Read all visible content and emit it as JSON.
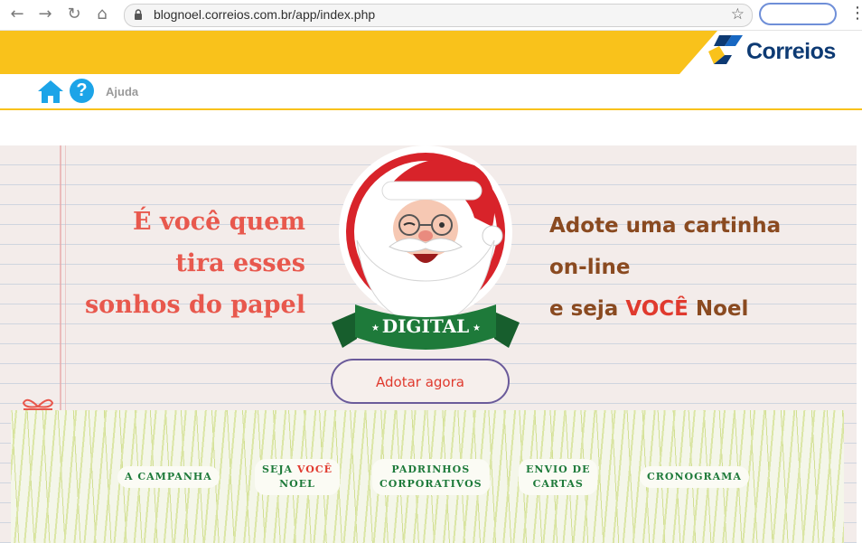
{
  "browser": {
    "url": "blognoel.correios.com.br/app/index.php"
  },
  "header": {
    "brand": "Correios",
    "help_link": "Ajuda"
  },
  "banner": {
    "left_lines": [
      "É você quem",
      "tira esses",
      "sonhos do papel"
    ],
    "right_line1": "Adote uma cartinha",
    "right_line2": "on-line",
    "right_line3_pre": "e seja ",
    "right_line3_hl": "VOCÊ",
    "right_line3_post": " Noel",
    "digital_ribbon": "DIGITAL",
    "adopt_button": "Adotar agora"
  },
  "menu": {
    "campanha": "A CAMPANHA",
    "seja_pre": "SEJA ",
    "seja_hl": "VOCÊ",
    "seja_post": "NOEL",
    "padrinhos_1": "PADRINHOS",
    "padrinhos_2": "CORPORATIVOS",
    "envio_1": "ENVIO DE",
    "envio_2": "CARTAS",
    "cronograma": "CRONOGRAMA"
  },
  "colors": {
    "yellow": "#f9c21b",
    "brand_blue": "#0d3a73",
    "santa_red": "#d8232a",
    "green": "#1e7a3a",
    "accent_red": "#e03a2e"
  }
}
